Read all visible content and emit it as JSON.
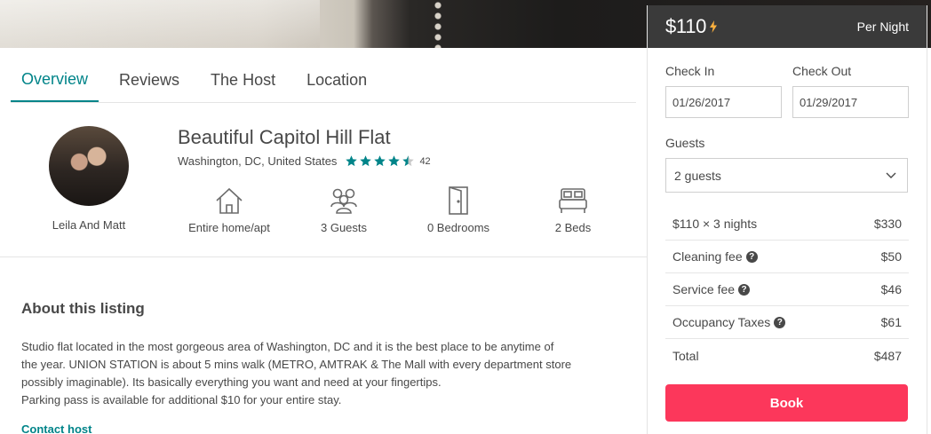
{
  "tabs": [
    {
      "label": "Overview",
      "active": true
    },
    {
      "label": "Reviews",
      "active": false
    },
    {
      "label": "The Host",
      "active": false
    },
    {
      "label": "Location",
      "active": false
    }
  ],
  "host": {
    "name": "Leila And Matt"
  },
  "listing": {
    "title": "Beautiful Capitol Hill Flat",
    "location": "Washington, DC, United States",
    "rating_stars": 4.5,
    "review_count": "42",
    "accent_color": "#008489"
  },
  "amenities": [
    {
      "icon": "home-icon",
      "label": "Entire home/apt"
    },
    {
      "icon": "guests-icon",
      "label": "3 Guests"
    },
    {
      "icon": "door-icon",
      "label": "0 Bedrooms"
    },
    {
      "icon": "bed-icon",
      "label": "2 Beds"
    }
  ],
  "about": {
    "title": "About this listing",
    "lines": [
      "Studio flat located in the most gorgeous area of Washington, DC and it is the best place to be anytime of",
      "the year. UNION STATION is about 5 mins walk (METRO, AMTRAK & The Mall with every department store",
      "possibly imaginable). Its basically everything you want and need at your fingertips.",
      "Parking pass is available for additional $10 for your entire stay."
    ],
    "contact_link": "Contact host"
  },
  "booking": {
    "price": "$110",
    "per_night": "Per Night",
    "check_in_label": "Check In",
    "check_in_value": "01/26/2017",
    "check_out_label": "Check Out",
    "check_out_value": "01/29/2017",
    "guests_label": "Guests",
    "guests_value": "2 guests",
    "breakdown": [
      {
        "label": "$110 × 3 nights",
        "amount": "$330",
        "help": false
      },
      {
        "label": "Cleaning fee",
        "amount": "$50",
        "help": true
      },
      {
        "label": "Service fee",
        "amount": "$46",
        "help": true
      },
      {
        "label": "Occupancy Taxes",
        "amount": "$61",
        "help": true
      },
      {
        "label": "Total",
        "amount": "$487",
        "help": false
      }
    ],
    "book_label": "Book",
    "book_color": "#fc375b"
  }
}
